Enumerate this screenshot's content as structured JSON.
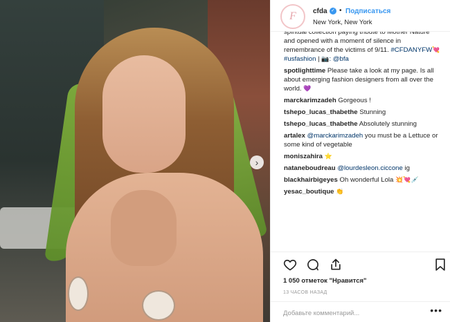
{
  "post": {
    "username": "cfda",
    "verified_symbol": "✓",
    "separator": "•",
    "follow_label": "Подписаться",
    "location": "New York, New York",
    "avatar_letter": "F",
    "next_button": "›"
  },
  "caption": {
    "text": "spiritual collection paying tribute to Mother Nature and opened with a moment of silence in remembrance of the victims of 9/11. ",
    "tag1": "#CFDANYFW",
    "emoji_heart": "💘",
    "tag2": "#usfashion",
    "separator": " | ",
    "emoji_camera": "📷",
    "mention": ": @bfa"
  },
  "comments": [
    {
      "user": "spotlighttime",
      "text": "Please take a look at my page. Is all about emerging fashion designers from all over the world.",
      "emoji": "💜"
    },
    {
      "user": "marckarimzadeh",
      "text": "Gorgeous !"
    },
    {
      "user": "tshepo_lucas_thabethe",
      "text": "Stunning"
    },
    {
      "user": "tshepo_lucas_thabethe",
      "text": "Absolutely stunning"
    },
    {
      "user": "artalex",
      "mention": "@marckarimzadeh",
      "text": " you must be a Lettuce or some kind of vegetable"
    },
    {
      "user": "moniszahira",
      "emoji": "⭐"
    },
    {
      "user": "nataneboudreau",
      "mention": "@lourdesleon.ciccone",
      "text": " ig"
    },
    {
      "user": "blackhairbigeyes",
      "text": "Oh wonderful Lola",
      "emoji": "💥💘💉"
    },
    {
      "user": "yesac_boutique",
      "emoji": "👏"
    }
  ],
  "actions": {
    "like_icon": "heart-icon",
    "comment_icon": "comment-icon",
    "share_icon": "share-icon",
    "save_icon": "bookmark-icon"
  },
  "likes": "1 050 отметок \"Нравится\"",
  "timestamp": "13 ЧАСОВ НАЗАД",
  "add_comment": {
    "placeholder": "Добавьте комментарий...",
    "more": "•••"
  },
  "colors": {
    "link": "#003569",
    "follow": "#3897f0",
    "avatar_ring": "#f2c5c8"
  }
}
